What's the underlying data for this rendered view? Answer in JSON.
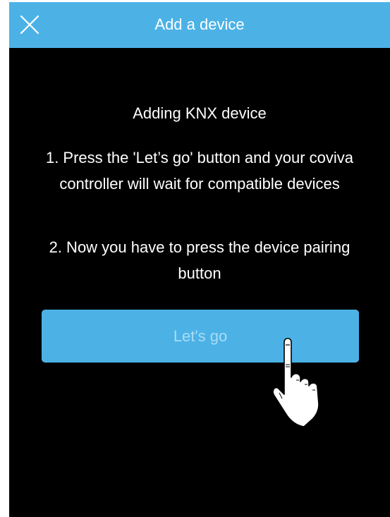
{
  "header": {
    "title": "Add a device",
    "close_icon": "close-icon"
  },
  "main": {
    "heading": "Adding KNX device",
    "step1": "1. Press the 'Let’s go' button and your coviva controller will wait for compatible devices",
    "step2": "2. Now you have to press the device pairing button",
    "button_label": "Let's go",
    "hint_icon": "pointing-hand-icon"
  },
  "colors": {
    "accent": "#4cb2e6",
    "background": "#000000",
    "button_text": "#a9dcf5"
  }
}
